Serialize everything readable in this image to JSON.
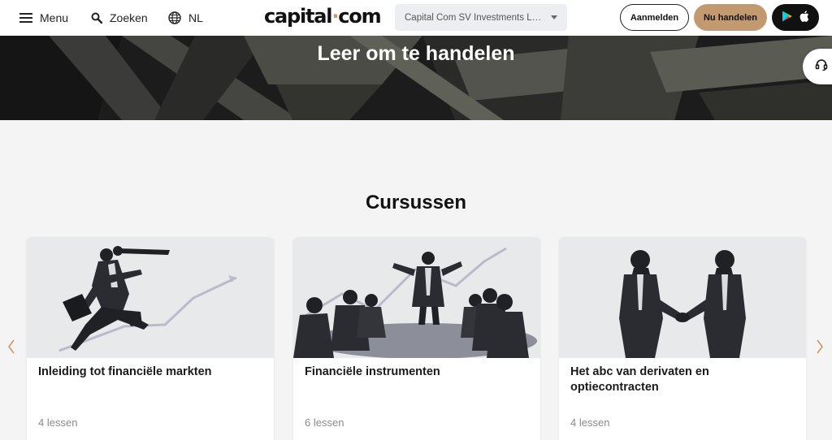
{
  "header": {
    "menu_label": "Menu",
    "search_label": "Zoeken",
    "language": "NL",
    "logo_left": "capital",
    "logo_dot": "·",
    "logo_right": "com",
    "entity_select": "Capital Com SV Investments Limited",
    "login_label": "Aanmelden",
    "trade_label": "Nu handelen"
  },
  "hero": {
    "title": "Leer om te handelen"
  },
  "section": {
    "title": "Cursussen"
  },
  "courses": [
    {
      "title": "Inleiding tot financiële markten",
      "lessons": "4 lessen"
    },
    {
      "title": "Financiële instrumenten",
      "lessons": "6 lessen"
    },
    {
      "title": "Het abc van derivaten en optiecontracten",
      "lessons": "4 lessen"
    }
  ],
  "colors": {
    "accent": "#c39a70",
    "hero_bg": "#1b1c1b",
    "page_bg": "#f4f4f5"
  },
  "icons": {
    "menu": "hamburger-icon",
    "search": "search-icon",
    "language": "globe-icon",
    "google_play": "google-play-icon",
    "apple": "apple-icon",
    "support": "headset-icon",
    "prev": "chevron-left-icon",
    "next": "chevron-right-icon"
  }
}
